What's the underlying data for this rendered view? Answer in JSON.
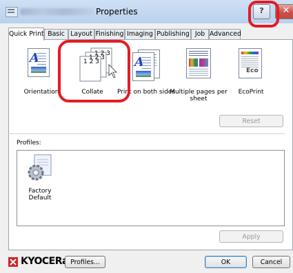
{
  "window": {
    "title": "Properties",
    "help_label": "?",
    "close_label": "✕"
  },
  "tabs": [
    {
      "label": "Quick Print",
      "active": true
    },
    {
      "label": "Basic"
    },
    {
      "label": "Layout"
    },
    {
      "label": "Finishing"
    },
    {
      "label": "Imaging"
    },
    {
      "label": "Publishing"
    },
    {
      "label": "Job"
    },
    {
      "label": "Advanced"
    }
  ],
  "quick_print": {
    "tiles": [
      {
        "label": "Orientation",
        "icon": "orientation-icon"
      },
      {
        "label": "Collate",
        "icon": "collate-icon"
      },
      {
        "label": "Print on both sides",
        "icon": "duplex-icon"
      },
      {
        "label": "Multiple pages per sheet",
        "icon": "multiple-pages-icon"
      },
      {
        "label": "EcoPrint",
        "icon": "ecoprint-icon"
      }
    ],
    "collate_pages": [
      "1 2 3",
      "1 2 3",
      "1 2 3"
    ],
    "eco_label": "Eco",
    "reset_label": "Reset"
  },
  "profiles": {
    "label": "Profiles:",
    "items": [
      {
        "label": "Factory Default",
        "icon": "factory-default-icon"
      }
    ],
    "apply_label": "Apply"
  },
  "footer": {
    "brand": "KYOCERa",
    "profiles_button": "Profiles...",
    "ok_label": "OK",
    "cancel_label": "Cancel"
  },
  "colors": {
    "highlight": "#e21c24",
    "brand_red": "#d2232a"
  }
}
